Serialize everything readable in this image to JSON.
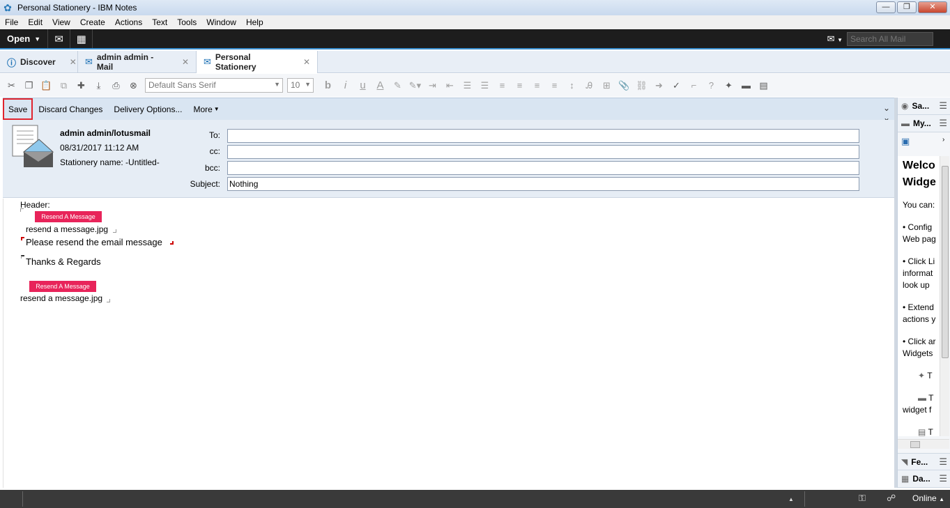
{
  "window": {
    "title": "Personal Stationery - IBM Notes",
    "buttons": {
      "minimize": "—",
      "maximize": "❐",
      "close": "✕"
    }
  },
  "menubar": [
    "File",
    "Edit",
    "View",
    "Create",
    "Actions",
    "Text",
    "Tools",
    "Window",
    "Help"
  ],
  "navbar": {
    "open_label": "Open",
    "search_placeholder": "Search All Mail"
  },
  "tabs": [
    {
      "label": "Discover",
      "icon": "info-icon"
    },
    {
      "label": "admin admin - Mail",
      "icon": "mail-icon"
    },
    {
      "label": "Personal Stationery",
      "icon": "stationery-icon",
      "active": true
    }
  ],
  "toolbar": {
    "font": "Default Sans Serif",
    "size": "10"
  },
  "actions": {
    "save": "Save",
    "discard": "Discard Changes",
    "delivery": "Delivery Options...",
    "more": "More"
  },
  "header": {
    "sender": "admin admin/lotusmail",
    "date": "08/31/2017 11:12 AM",
    "stationery_name": "Stationery name: -Untitled-",
    "fields": {
      "to_label": "To:",
      "to_value": "",
      "cc_label": "cc:",
      "cc_value": "",
      "bcc_label": "bcc:",
      "bcc_value": "",
      "subject_label": "Subject:",
      "subject_value": "Nothing"
    }
  },
  "body": {
    "header_label": "Header:",
    "image_text": "Resend A Message",
    "image_filename": "resend a message.jpg",
    "line1": "Please resend the email message",
    "line2": "Thanks & Regards",
    "image2_text": "Resend A Message",
    "image2_filename": "resend a message.jpg"
  },
  "sidebar": {
    "sametime": "Sa...",
    "mywidgets": "My...",
    "welcome_title_1": "Welco",
    "welcome_title_2": "Widge",
    "you_can": "You can:",
    "b1_l1": "• Config",
    "b1_l2": "Web pag",
    "b2_l1": "• Click Li",
    "b2_l2": "informat",
    "b2_l3": "look up",
    "b3_l1": "• Extend",
    "b3_l2": "actions y",
    "b4_l1": "• Click ar",
    "b4_l2": "Widgets",
    "i1": "T",
    "i2": "T",
    "i2_l2": "widget f",
    "i3": "T",
    "feeds": "Fe...",
    "day": "Da..."
  },
  "status": {
    "online": "Online"
  }
}
